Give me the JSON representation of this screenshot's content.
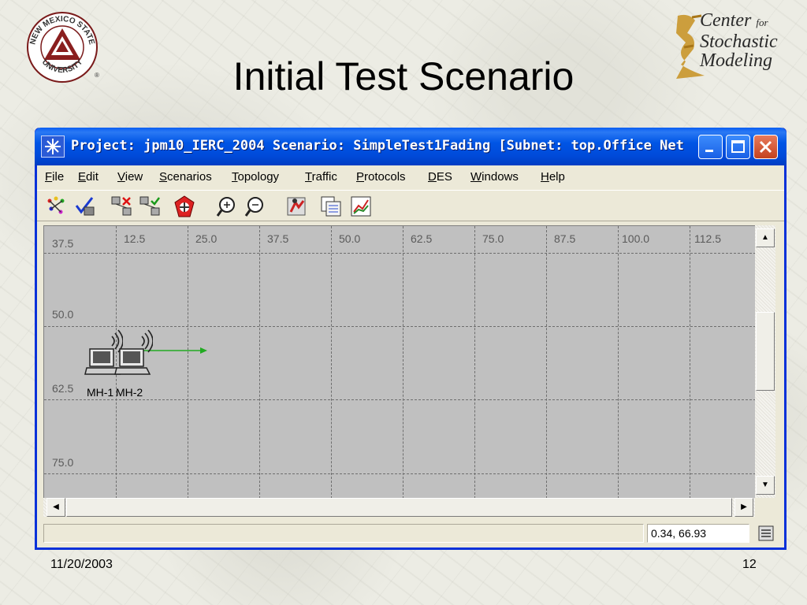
{
  "slide": {
    "title": "Initial Test Scenario",
    "date": "11/20/2003",
    "page_number": "12"
  },
  "logos": {
    "left": {
      "name": "new-mexico-state-university-seal",
      "top_text": "NEW MEXICO STATE",
      "bottom_text": "UNIVERSITY",
      "mark": "®"
    },
    "right": {
      "name": "center-for-stochastic-modeling-logo",
      "line1": "Center",
      "line1_suffix": "for",
      "line2": "Stochastic",
      "line3": "Modeling"
    }
  },
  "window": {
    "title": "Project: jpm10_IERC_2004 Scenario: SimpleTest1Fading  [Subnet: top.Office Net...",
    "menu": [
      "File",
      "Edit",
      "View",
      "Scenarios",
      "Topology",
      "Traffic",
      "Protocols",
      "DES",
      "Windows",
      "Help"
    ],
    "toolbar_icons": [
      "open-palette-icon",
      "verify-links-icon",
      "fail-node-icon",
      "recover-node-icon",
      "configure-simulation-icon",
      "zoom-in-icon",
      "zoom-out-icon",
      "run-simulation-icon",
      "view-results-icon",
      "graph-results-icon"
    ]
  },
  "canvas": {
    "x_labels": [
      "12.5",
      "25.0",
      "37.5",
      "50.0",
      "62.5",
      "75.0",
      "87.5",
      "100.0",
      "112.5"
    ],
    "y_labels": [
      "37.5",
      "50.0",
      "62.5",
      "75.0"
    ],
    "nodes": [
      {
        "label": "MH-1",
        "icon": "wireless-laptop-icon"
      },
      {
        "label": "MH-2",
        "icon": "wireless-laptop-icon"
      }
    ],
    "link_color": "#22aa22"
  },
  "status": {
    "coordinates": "0.34, 66.93"
  },
  "colors": {
    "title_bar": "#0055e5",
    "canvas_bg": "#c0c0c0",
    "window_bg": "#ece9d8"
  }
}
